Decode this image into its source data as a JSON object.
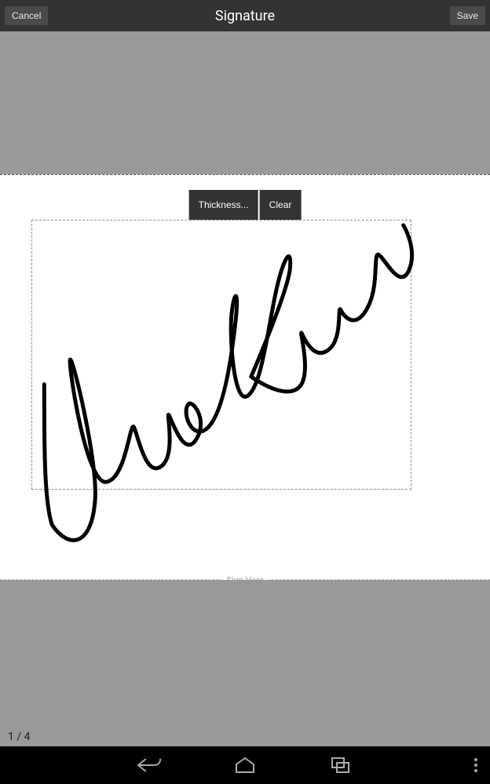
{
  "appBar": {
    "cancel": "Cancel",
    "title": "Signature",
    "save": "Save"
  },
  "tools": {
    "thickness": "Thickness...",
    "clear": "Clear"
  },
  "signHere": "Sign Here",
  "page": {
    "current": "1",
    "sep": "  / ",
    "total": "4"
  }
}
